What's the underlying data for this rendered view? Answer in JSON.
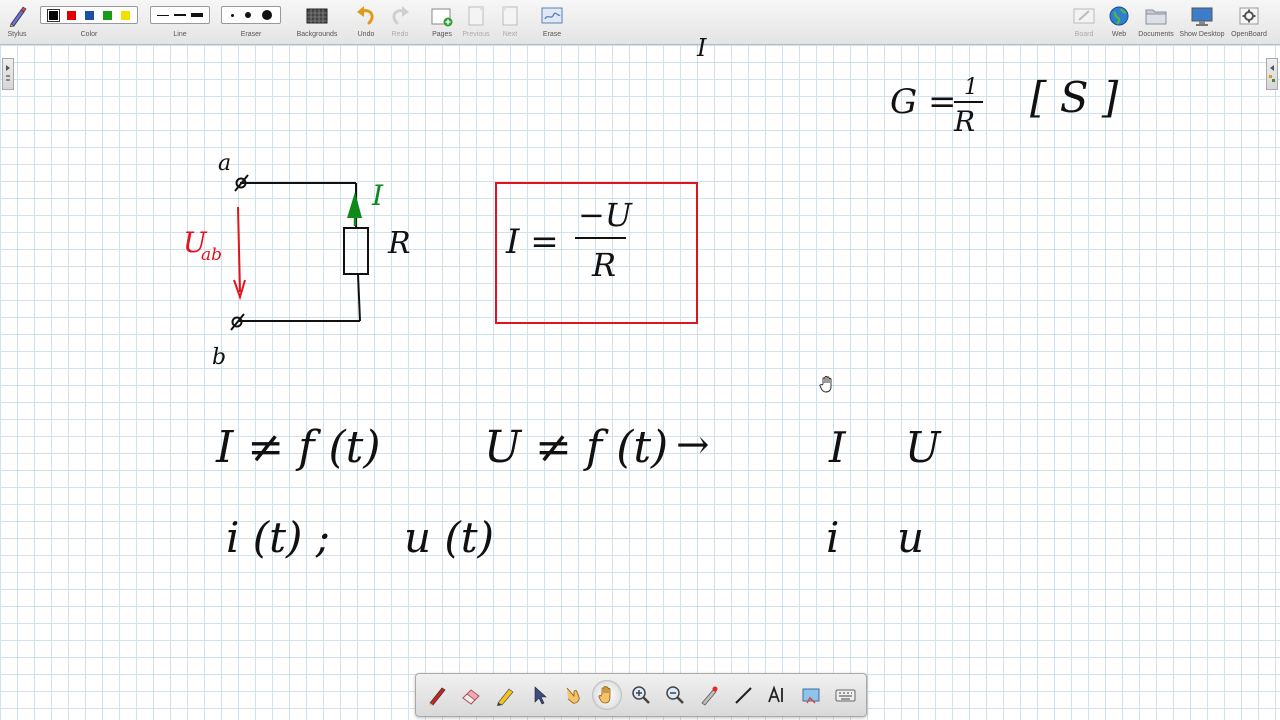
{
  "toolbar": {
    "stylus_label": "Stylus",
    "color_label": "Color",
    "line_label": "Line",
    "eraser_label": "Eraser",
    "backgrounds_label": "Backgrounds",
    "undo_label": "Undo",
    "redo_label": "Redo",
    "pages_label": "Pages",
    "previous_label": "Previous",
    "next_label": "Next",
    "erase_label": "Erase",
    "board_label": "Board",
    "web_label": "Web",
    "documents_label": "Documents",
    "show_desktop_label": "Show Desktop",
    "openboard_label": "OpenBoard",
    "colors": [
      "#000000",
      "#e00000",
      "#1c4fa8",
      "#1a9a1a",
      "#f0e000"
    ],
    "selected_color": "#000000"
  },
  "board": {
    "node_a": "a",
    "node_b": "b",
    "current_label": "I",
    "voltage_label": "U",
    "voltage_sub": "ab",
    "resistor_label": "R",
    "boxed_formula": {
      "lhs": "I =",
      "numerator": "−U",
      "denominator": "R"
    },
    "conductance": {
      "lhs": "G =",
      "numerator": "1",
      "denominator": "R",
      "unit": "[ S ]"
    },
    "line1_left": "I ≠ f (t)",
    "line1_mid": "U ≠ f (t)",
    "arrow": "→",
    "line1_right_I": "I",
    "line1_right_U": "U",
    "line2_left": "i (t)  ;",
    "line2_mid": "u (t)",
    "line2_right_i": "i",
    "line2_right_u": "u",
    "top_fragment": "I"
  },
  "colors": {
    "ink_black": "#111111",
    "ink_red": "#e0141e",
    "ink_green": "#0f8a1a",
    "grid": "#cfe2ee"
  }
}
